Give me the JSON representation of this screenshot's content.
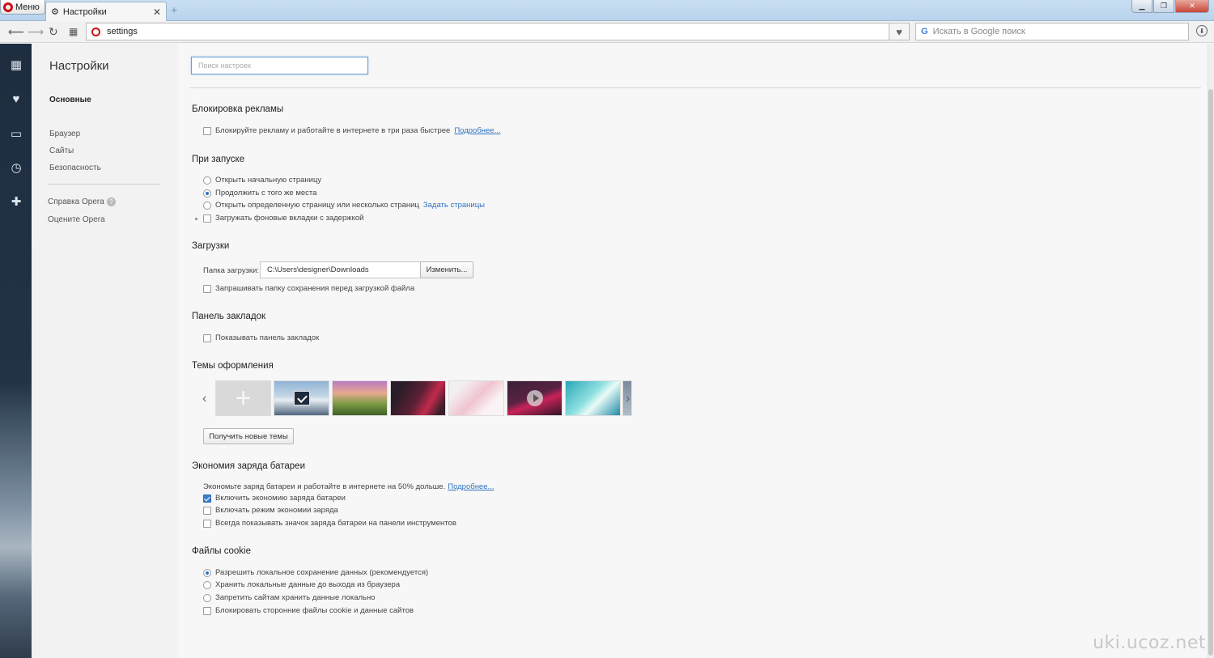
{
  "tabbar": {
    "menu_label": "Меню",
    "tab_title": "Настройки",
    "tab_close": "✕",
    "newtab": "+"
  },
  "toolbar": {
    "url": "settings",
    "search_placeholder": "Искать в Google поиск"
  },
  "nav": {
    "title": "Настройки",
    "items": [
      "Основные",
      "Браузер",
      "Сайты",
      "Безопасность"
    ],
    "help": "Справка Opera",
    "rate": "Оцените Opera"
  },
  "main": {
    "search_placeholder": "Поиск настроек",
    "adblock": {
      "title": "Блокировка рекламы",
      "option": "Блокируйте рекламу и работайте в интернете в три раза быстрее",
      "more": "Подробнее..."
    },
    "startup": {
      "title": "При запуске",
      "opt1": "Открыть начальную страницу",
      "opt2": "Продолжить с того же места",
      "opt3": "Открыть определенную страницу или несколько страниц",
      "opt3_link": "Задать страницы",
      "opt4": "Загружать фоновые вкладки с задержкой"
    },
    "downloads": {
      "title": "Загрузки",
      "folder_label": "Папка загрузки:",
      "folder_path": "C:\\Users\\designer\\Downloads",
      "change_button": "Изменить...",
      "ask": "Запрашивать папку сохранения перед загрузкой файла"
    },
    "bookmarks": {
      "title": "Панель закладок",
      "show": "Показывать панель закладок"
    },
    "themes": {
      "title": "Темы оформления",
      "get_more": "Получить новые темы"
    },
    "battery": {
      "title": "Экономия заряда батареи",
      "desc": "Экономьте заряд батареи и работайте в интернете на 50% дольше.",
      "more": "Подробнее...",
      "opt1": "Включить экономию заряда батареи",
      "opt2": "Включать режим экономии заряда",
      "opt3": "Всегда показывать значок заряда батареи на панели инструментов"
    },
    "cookies": {
      "title": "Файлы cookie",
      "opt1": "Разрешить локальное сохранение данных (рекомендуется)",
      "opt2": "Хранить локальные данные до выхода из браузера",
      "opt3": "Запретить сайтам хранить данные локально",
      "opt4": "Блокировать сторонние файлы cookie и данные сайтов"
    }
  },
  "watermark": "uki.ucoz.net"
}
